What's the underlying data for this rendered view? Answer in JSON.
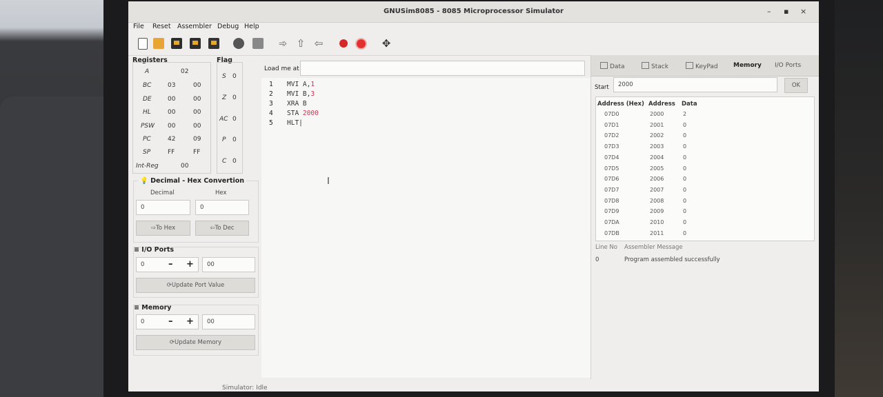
{
  "window": {
    "title": "GNUSim8085 - 8085 Microprocessor Simulator",
    "min": "–",
    "max": "▪",
    "close": "×"
  },
  "menu": [
    "File",
    "Reset",
    "Assembler",
    "Debug",
    "Help"
  ],
  "registers": {
    "title": "Registers",
    "rows": [
      {
        "name": "A",
        "v1": "02",
        "v2": ""
      },
      {
        "name": "BC",
        "v1": "03",
        "v2": "00"
      },
      {
        "name": "DE",
        "v1": "00",
        "v2": "00"
      },
      {
        "name": "HL",
        "v1": "00",
        "v2": "00"
      },
      {
        "name": "PSW",
        "v1": "00",
        "v2": "00"
      },
      {
        "name": "PC",
        "v1": "42",
        "v2": "09"
      },
      {
        "name": "SP",
        "v1": "FF",
        "v2": "FF"
      },
      {
        "name": "Int-Reg",
        "v1": "00",
        "v2": ""
      }
    ]
  },
  "flags": {
    "title": "Flag",
    "rows": [
      {
        "name": "S",
        "v": "0"
      },
      {
        "name": "Z",
        "v": "0"
      },
      {
        "name": "AC",
        "v": "0"
      },
      {
        "name": "P",
        "v": "0"
      },
      {
        "name": "C",
        "v": "0"
      }
    ]
  },
  "dechex": {
    "title": "Decimal - Hex Convertion",
    "decimal_label": "Decimal",
    "hex_label": "Hex",
    "decimal_value": "0",
    "hex_value": "0",
    "to_hex": "To Hex",
    "to_dec": "To Dec"
  },
  "ioports": {
    "title": "I/O Ports",
    "port": "0",
    "value": "00",
    "minus": "–",
    "plus": "+",
    "update": "Update Port Value"
  },
  "memory": {
    "title": "Memory",
    "addr": "0",
    "value": "00",
    "minus": "–",
    "plus": "+",
    "update": "Update Memory"
  },
  "editor": {
    "load_label": "Load me at",
    "load_value": "",
    "lines": [
      {
        "num": "1",
        "mn": "MVI",
        "ops": "A,",
        "val": "1"
      },
      {
        "num": "2",
        "mn": "MVI",
        "ops": "B,",
        "val": "3"
      },
      {
        "num": "3",
        "mn": "XRA",
        "ops": "B",
        "val": ""
      },
      {
        "num": "4",
        "mn": "STA",
        "ops": "",
        "val": "2000"
      },
      {
        "num": "5",
        "mn": "HLT",
        "ops": "",
        "val": ""
      }
    ]
  },
  "rtabs": [
    "Data",
    "Stack",
    "KeyPad",
    "Memory",
    "I/O Ports"
  ],
  "mem": {
    "start_label": "Start",
    "start_value": "2000",
    "ok": "OK",
    "headers": [
      "Address (Hex)",
      "Address",
      "Data"
    ],
    "rows": [
      [
        "07D0",
        "2000",
        "2"
      ],
      [
        "07D1",
        "2001",
        "0"
      ],
      [
        "07D2",
        "2002",
        "0"
      ],
      [
        "07D3",
        "2003",
        "0"
      ],
      [
        "07D4",
        "2004",
        "0"
      ],
      [
        "07D5",
        "2005",
        "0"
      ],
      [
        "07D6",
        "2006",
        "0"
      ],
      [
        "07D7",
        "2007",
        "0"
      ],
      [
        "07D8",
        "2008",
        "0"
      ],
      [
        "07D9",
        "2009",
        "0"
      ],
      [
        "07DA",
        "2010",
        "0"
      ],
      [
        "07DB",
        "2011",
        "0"
      ]
    ]
  },
  "messages": {
    "headers": [
      "Line No",
      "Assembler Message"
    ],
    "rows": [
      [
        "0",
        "Program assembled successfully"
      ]
    ]
  },
  "status": "Simulator: Idle"
}
